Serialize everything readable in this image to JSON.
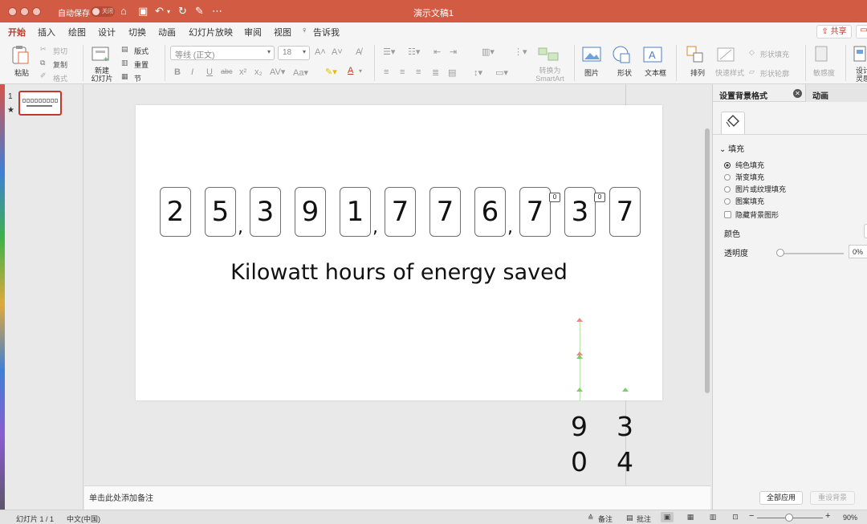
{
  "titlebar": {
    "autosave_label": "自动保存",
    "autosave_state": "关闭",
    "document_title": "演示文稿1"
  },
  "tabs": [
    "开始",
    "插入",
    "绘图",
    "设计",
    "切换",
    "动画",
    "幻灯片放映",
    "审阅",
    "视图",
    "告诉我"
  ],
  "share_label": "共享",
  "ribbon": {
    "paste": "粘贴",
    "cut": "剪切",
    "copy": "复制",
    "format_painter": "格式",
    "new_slide": "新建\n幻灯片",
    "layout": "版式",
    "reset": "重置",
    "section": "节",
    "font_name": "等线 (正文)",
    "font_size": "18",
    "convert_smartart": "转换为\nSmartArt",
    "picture": "图片",
    "shapes": "形状",
    "textbox": "文本框",
    "arrange": "排列",
    "quick_styles": "快速样式",
    "shape_fill": "形状填充",
    "shape_outline": "形状轮廓",
    "sensitivity": "敏感度",
    "designer": "设计\n灵感"
  },
  "thumbnail": {
    "number": "1",
    "star": "★"
  },
  "slide": {
    "digits": [
      "2",
      "5",
      "3",
      "9",
      "1",
      "7",
      "7",
      "6",
      "7",
      "3",
      "7"
    ],
    "commas": [
      ",",
      ",",
      ","
    ],
    "mini_boxes": [
      "0",
      "0"
    ],
    "caption": "Kilowatt hours of energy saved",
    "spill_digits": [
      "9",
      "3",
      "0",
      "4"
    ]
  },
  "notes_placeholder": "单击此处添加备注",
  "format_pane": {
    "title": "设置背景格式",
    "tab2": "动画",
    "section": "填充",
    "options": [
      "纯色填充",
      "渐变填充",
      "图片或纹理填充",
      "图案填充"
    ],
    "hide_bg": "隐藏背景图形",
    "color_label": "颜色",
    "transparency_label": "透明度",
    "transparency_value": "0%",
    "apply_all": "全部应用",
    "reset_bg": "重设背景"
  },
  "status": {
    "slide_of": "幻灯片 1 / 1",
    "language": "中文(中国)",
    "notes": "备注",
    "comments": "批注",
    "zoom": "90%"
  }
}
